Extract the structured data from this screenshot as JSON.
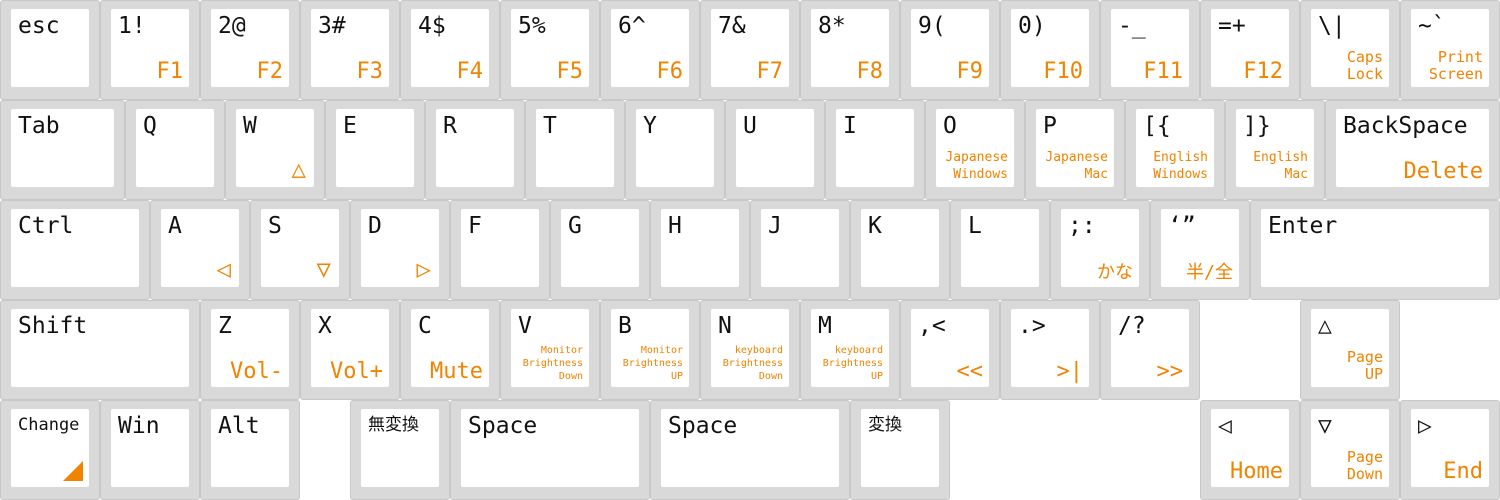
{
  "rows": [
    [
      {
        "main": "esc"
      },
      {
        "main": "1!",
        "sub": "F1"
      },
      {
        "main": "2@",
        "sub": "F2"
      },
      {
        "main": "3#",
        "sub": "F3"
      },
      {
        "main": "4$",
        "sub": "F4"
      },
      {
        "main": "5%",
        "sub": "F5"
      },
      {
        "main": "6^",
        "sub": "F6"
      },
      {
        "main": "7&",
        "sub": "F7"
      },
      {
        "main": "8*",
        "sub": "F8"
      },
      {
        "main": "9(",
        "sub": "F9"
      },
      {
        "main": "0)",
        "sub": "F10"
      },
      {
        "main": "-_",
        "sub": "F11"
      },
      {
        "main": "=+",
        "sub": "F12"
      },
      {
        "main": "\\|",
        "sub": "Caps\nLock"
      },
      {
        "main": "~`",
        "sub": "Print\nScreen"
      }
    ],
    [
      {
        "main": "Tab"
      },
      {
        "main": "Q"
      },
      {
        "main": "W",
        "sub": "△"
      },
      {
        "main": "E"
      },
      {
        "main": "R"
      },
      {
        "main": "T"
      },
      {
        "main": "Y"
      },
      {
        "main": "U"
      },
      {
        "main": "I"
      },
      {
        "main": "O",
        "sub": "Japanese\nWindows"
      },
      {
        "main": "P",
        "sub": "Japanese\nMac"
      },
      {
        "main": "[{",
        "sub": "English\nWindows"
      },
      {
        "main": "]}",
        "sub": "English\nMac"
      },
      {
        "main": "BackSpace",
        "sub": "Delete"
      }
    ],
    [
      {
        "main": "Ctrl"
      },
      {
        "main": "A",
        "sub": "◁"
      },
      {
        "main": "S",
        "sub": "▽"
      },
      {
        "main": "D",
        "sub": "▷"
      },
      {
        "main": "F"
      },
      {
        "main": "G"
      },
      {
        "main": "H"
      },
      {
        "main": "J"
      },
      {
        "main": "K"
      },
      {
        "main": "L"
      },
      {
        "main": ";:",
        "sub": "かな"
      },
      {
        "main": "‘”",
        "sub": "半/全"
      },
      {
        "main": "Enter"
      }
    ],
    [
      {
        "main": "Shift"
      },
      {
        "main": "Z",
        "sub": "Vol-"
      },
      {
        "main": "X",
        "sub": "Vol+"
      },
      {
        "main": "C",
        "sub": "Mute"
      },
      {
        "main": "V",
        "sub": "Monitor\nBrightness\nDown"
      },
      {
        "main": "B",
        "sub": "Monitor\nBrightness\nUP"
      },
      {
        "main": "N",
        "sub": "keyboard\nBrightness\nDown"
      },
      {
        "main": "M",
        "sub": "keyboard\nBrightness\nUP"
      },
      {
        "main": ",<",
        "sub": "<<"
      },
      {
        "main": ".>",
        "sub": ">|"
      },
      {
        "main": "/?",
        "sub": ">>"
      },
      {
        "main": "△",
        "sub": "Page\nUP"
      }
    ],
    [
      {
        "main": "Change",
        "corner": "orange-triangle"
      },
      {
        "main": "Win"
      },
      {
        "main": "Alt"
      },
      {
        "main": "無変換"
      },
      {
        "main": "Space"
      },
      {
        "main": "Space"
      },
      {
        "main": "変換"
      },
      {
        "main": "◁",
        "sub": "Home"
      },
      {
        "main": "▽",
        "sub": "Page\nDown"
      },
      {
        "main": "▷",
        "sub": "End"
      }
    ]
  ],
  "colors": {
    "key_border": "#d9d9d9",
    "cap": "#ffffff",
    "legend": "#111111",
    "fn_legend": "#f08300"
  }
}
